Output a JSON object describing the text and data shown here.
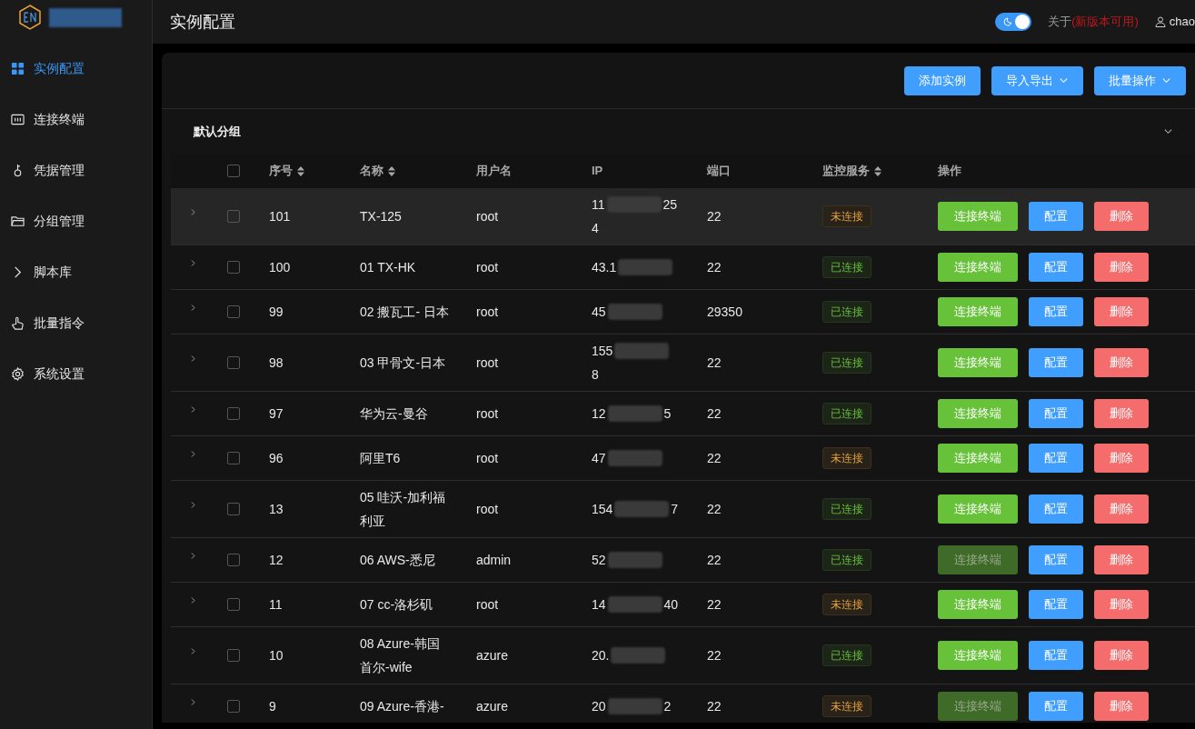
{
  "header": {
    "title": "实例配置",
    "theme_dark": true,
    "about": "关于",
    "about_note": "(新版本可用)",
    "user": "chao"
  },
  "sidebar": {
    "items": [
      {
        "label": "实例配置",
        "selected": true
      },
      {
        "label": "连接终端",
        "selected": false
      },
      {
        "label": "凭据管理",
        "selected": false
      },
      {
        "label": "分组管理",
        "selected": false
      },
      {
        "label": "脚本库",
        "selected": false
      },
      {
        "label": "批量指令",
        "selected": false
      },
      {
        "label": "系统设置",
        "selected": false
      }
    ]
  },
  "toolbar": [
    {
      "label": "添加实例",
      "dropdown": false
    },
    {
      "label": "导入导出",
      "dropdown": true
    },
    {
      "label": "批量操作",
      "dropdown": true
    }
  ],
  "group": {
    "title": "默认分组",
    "expanded": true
  },
  "table": {
    "select_all": false,
    "columns": [
      {
        "label": "序号",
        "sortable": true
      },
      {
        "label": "名称",
        "sortable": true
      },
      {
        "label": "用户名",
        "sortable": false
      },
      {
        "label": "IP",
        "sortable": false
      },
      {
        "label": "端口",
        "sortable": false
      },
      {
        "label": "监控服务",
        "sortable": true
      },
      {
        "label": "操作",
        "sortable": false
      }
    ],
    "rows": [
      {
        "id": "101",
        "name": "TX-125",
        "user": "root",
        "ip_start": "11",
        "ip_end": "25",
        "ip_tail": "4",
        "port": "22",
        "status": "未连接",
        "connected": false,
        "terminal": "连接终端",
        "terminal_disabled": false,
        "config": "配置",
        "delete": "删除",
        "highlighted": true,
        "checked": false
      },
      {
        "id": "100",
        "name": "01 TX-HK",
        "user": "root",
        "ip_start": "43.1",
        "ip_end": "",
        "ip_tail": "",
        "port": "22",
        "status": "已连接",
        "connected": true,
        "terminal": "连接终端",
        "terminal_disabled": false,
        "config": "配置",
        "delete": "删除",
        "highlighted": false,
        "checked": false
      },
      {
        "id": "99",
        "name": "02 搬瓦工- 日本",
        "user": "root",
        "ip_start": "45",
        "ip_end": "",
        "ip_tail": "",
        "port": "29350",
        "status": "已连接",
        "connected": true,
        "terminal": "连接终端",
        "terminal_disabled": false,
        "config": "配置",
        "delete": "删除",
        "highlighted": false,
        "checked": false
      },
      {
        "id": "98",
        "name": "03 甲骨文-日本",
        "user": "root",
        "ip_start": "155",
        "ip_end": "",
        "ip_tail": "8",
        "port": "22",
        "status": "已连接",
        "connected": true,
        "terminal": "连接终端",
        "terminal_disabled": false,
        "config": "配置",
        "delete": "删除",
        "highlighted": false,
        "checked": false
      },
      {
        "id": "97",
        "name": "华为云-曼谷",
        "user": "root",
        "ip_start": "12",
        "ip_end": "5",
        "ip_tail": "",
        "port": "22",
        "status": "已连接",
        "connected": true,
        "terminal": "连接终端",
        "terminal_disabled": false,
        "config": "配置",
        "delete": "删除",
        "highlighted": false,
        "checked": false
      },
      {
        "id": "96",
        "name": "阿里T6",
        "user": "root",
        "ip_start": "47",
        "ip_end": "",
        "ip_tail": "",
        "port": "22",
        "status": "未连接",
        "connected": false,
        "terminal": "连接终端",
        "terminal_disabled": false,
        "config": "配置",
        "delete": "删除",
        "highlighted": false,
        "checked": false
      },
      {
        "id": "13",
        "name": "05 哇沃-加利福利亚",
        "user": "root",
        "ip_start": "154",
        "ip_end": "7",
        "ip_tail": "",
        "port": "22",
        "status": "已连接",
        "connected": true,
        "terminal": "连接终端",
        "terminal_disabled": false,
        "config": "配置",
        "delete": "删除",
        "highlighted": false,
        "checked": false
      },
      {
        "id": "12",
        "name": "06 AWS-悉尼",
        "user": "admin",
        "ip_start": "52",
        "ip_end": "",
        "ip_tail": "",
        "port": "22",
        "status": "已连接",
        "connected": true,
        "terminal": "连接终端",
        "terminal_disabled": true,
        "config": "配置",
        "delete": "删除",
        "highlighted": false,
        "checked": false
      },
      {
        "id": "11",
        "name": "07 cc-洛杉矶",
        "user": "root",
        "ip_start": "14",
        "ip_end": "40",
        "ip_tail": "",
        "port": "22",
        "status": "未连接",
        "connected": false,
        "terminal": "连接终端",
        "terminal_disabled": false,
        "config": "配置",
        "delete": "删除",
        "highlighted": false,
        "checked": false
      },
      {
        "id": "10",
        "name": "08 Azure-韩国首尔-wife",
        "user": "azure",
        "ip_start": "20.",
        "ip_end": "",
        "ip_tail": "",
        "port": "22",
        "status": "已连接",
        "connected": true,
        "terminal": "连接终端",
        "terminal_disabled": false,
        "config": "配置",
        "delete": "删除",
        "highlighted": false,
        "checked": false
      },
      {
        "id": "9",
        "name": "09 Azure-香港-",
        "user": "azure",
        "ip_start": "20",
        "ip_end": "2",
        "ip_tail": "",
        "port": "22",
        "status": "未连接",
        "connected": false,
        "terminal": "连接终端",
        "terminal_disabled": true,
        "config": "配置",
        "delete": "删除",
        "highlighted": false,
        "checked": false
      }
    ]
  }
}
